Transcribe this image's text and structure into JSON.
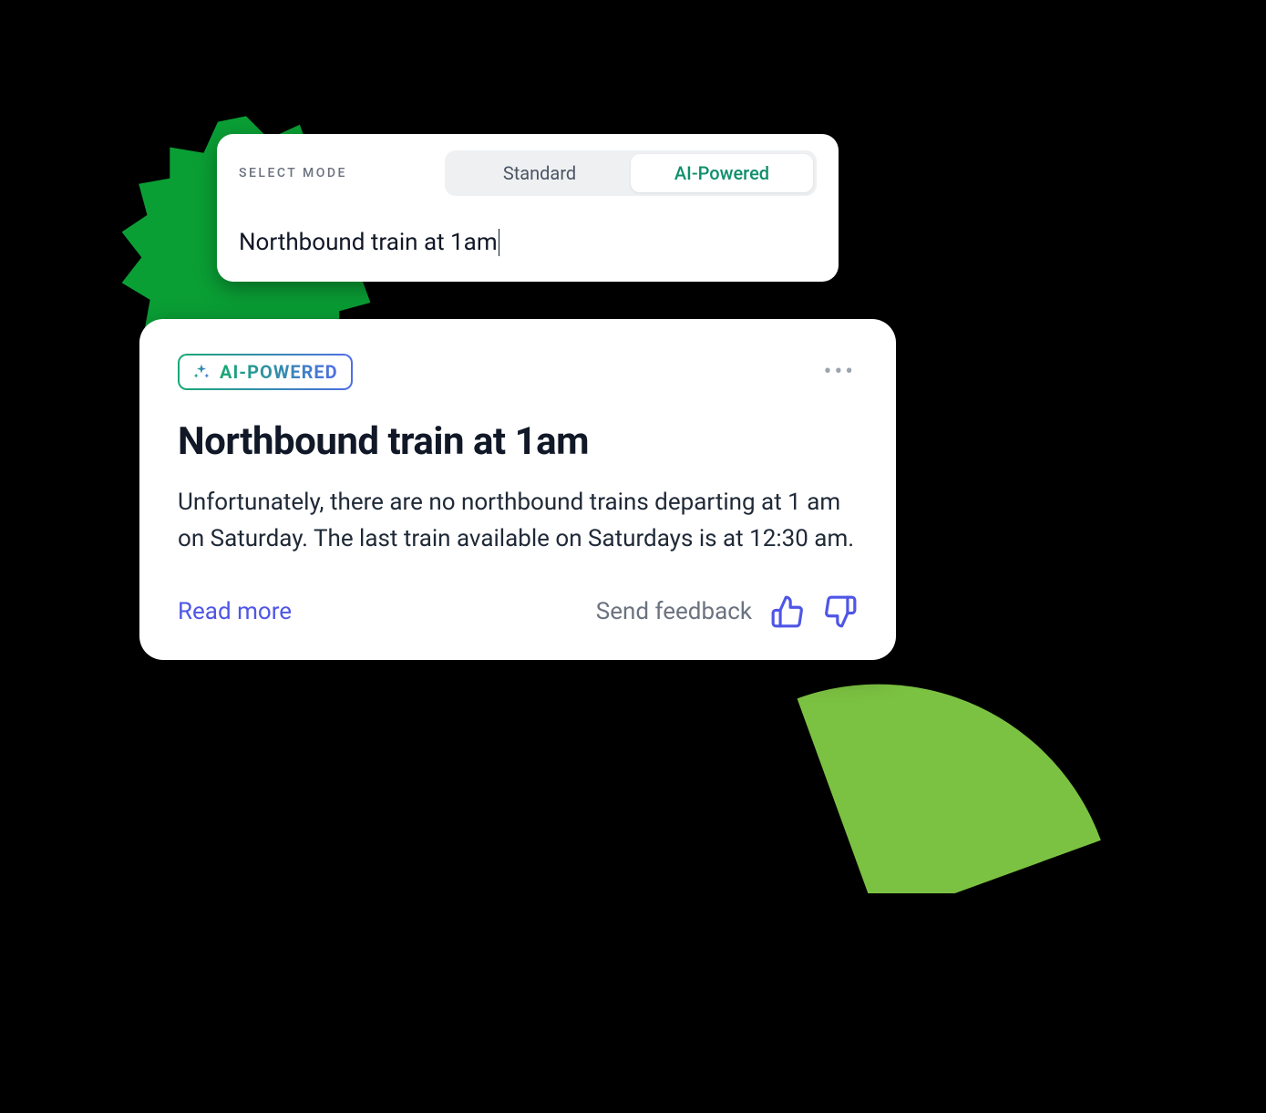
{
  "mode": {
    "label": "SELECT MODE",
    "options": {
      "standard": "Standard",
      "ai": "AI-Powered"
    },
    "active": "ai"
  },
  "search": {
    "query": "Northbound train at 1am"
  },
  "result": {
    "badge_label": "AI-POWERED",
    "title": "Northbound train at 1am",
    "body": "Unfortunately, there are no northbound trains departing at 1 am on Saturday. The last train available on Saturdays is at 12:30 am.",
    "read_more": "Read more",
    "feedback_label": "Send feedback"
  },
  "colors": {
    "accent_green_dark": "#0a9f35",
    "accent_green_light": "#7cc242",
    "link": "#4f56e6",
    "ai_teal": "#0f8f6a"
  }
}
